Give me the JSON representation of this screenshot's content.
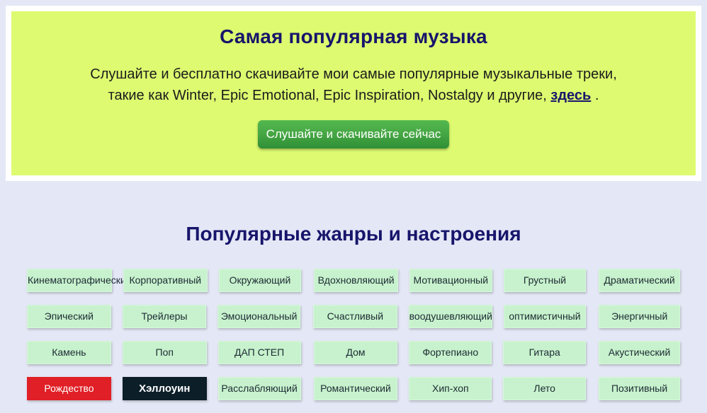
{
  "promo": {
    "title": "Самая популярная музыка",
    "body_part1": "Слушайте и бесплатно скачивайте мои самые популярные музыкальные треки, такие как Winter, Epic Emotional, Epic Inspiration, Nostalgy и другие, ",
    "link_label": "здесь",
    "body_part2": " .",
    "cta_label": "Слушайте и скачивайте сейчас",
    "panel_color": "#ddfa70",
    "title_color": "#17156b",
    "cta_color": "#47a845"
  },
  "genres": {
    "title": "Популярные жанры и настроения",
    "title_color": "#17156b",
    "tag_color": "#c7f2cd",
    "rows": [
      [
        {
          "label": "Кинематографический",
          "style": "normal"
        },
        {
          "label": "Корпоративный",
          "style": "normal"
        },
        {
          "label": "Окружающий",
          "style": "normal"
        },
        {
          "label": "Вдохновляющий",
          "style": "normal"
        },
        {
          "label": "Мотивационный",
          "style": "normal"
        },
        {
          "label": "Грустный",
          "style": "normal"
        },
        {
          "label": "Драматический",
          "style": "normal"
        }
      ],
      [
        {
          "label": "Эпический",
          "style": "normal"
        },
        {
          "label": "Трейлеры",
          "style": "normal"
        },
        {
          "label": "Эмоциональный",
          "style": "normal"
        },
        {
          "label": "Счастливый",
          "style": "normal"
        },
        {
          "label": "воодушевляющий",
          "style": "normal"
        },
        {
          "label": "оптимистичный",
          "style": "normal"
        },
        {
          "label": "Энергичный",
          "style": "normal"
        }
      ],
      [
        {
          "label": "Камень",
          "style": "normal"
        },
        {
          "label": "Поп",
          "style": "normal"
        },
        {
          "label": "ДАП СТЕП",
          "style": "normal"
        },
        {
          "label": "Дом",
          "style": "normal"
        },
        {
          "label": "Фортепиано",
          "style": "normal"
        },
        {
          "label": "Гитара",
          "style": "normal"
        },
        {
          "label": "Акустический",
          "style": "normal"
        }
      ],
      [
        {
          "label": "Рождество",
          "style": "holiday-red"
        },
        {
          "label": "Хэллоуин",
          "style": "holiday-dark"
        },
        {
          "label": "Расслабляющий",
          "style": "normal"
        },
        {
          "label": "Романтический",
          "style": "normal"
        },
        {
          "label": "Хип-хоп",
          "style": "normal"
        },
        {
          "label": "Лето",
          "style": "normal"
        },
        {
          "label": "Позитивный",
          "style": "normal"
        }
      ]
    ]
  }
}
